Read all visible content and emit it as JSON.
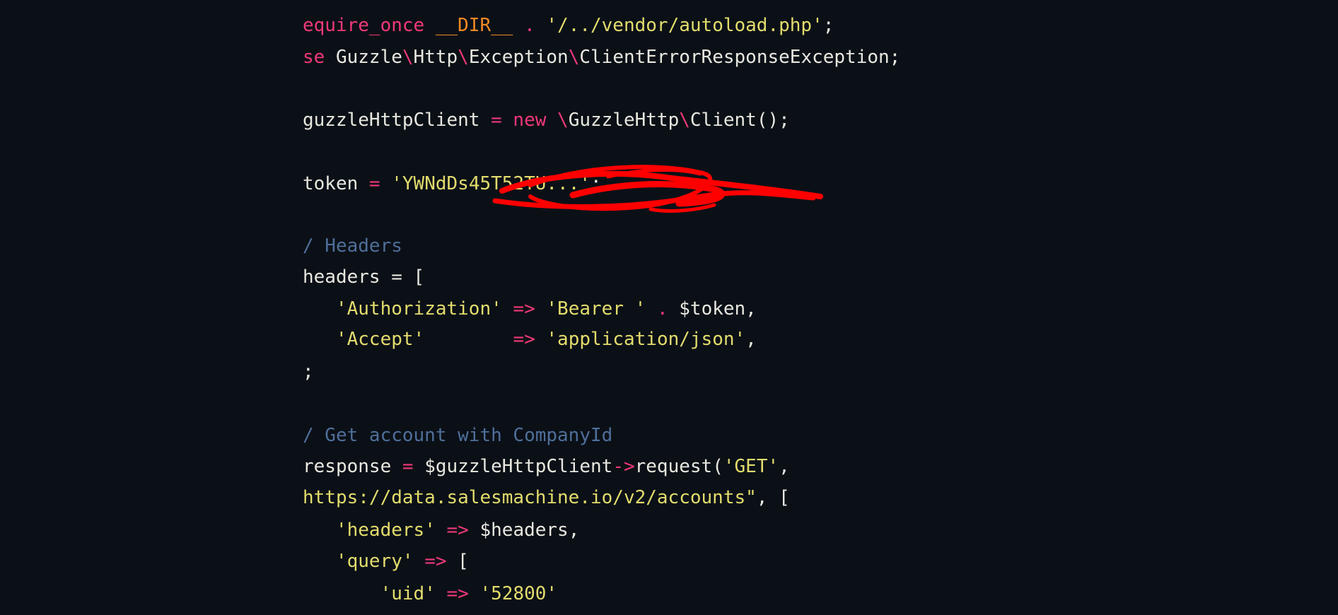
{
  "code": {
    "line1": {
      "kw": "equire_once",
      "sp1": " ",
      "const": "__DIR__",
      "op": " . ",
      "str": "'/../vendor/autoload.php'",
      "end": ";"
    },
    "line2": {
      "kw": "se",
      "ns1": " Guzzle",
      "sep1": "\\",
      "ns2": "Http",
      "sep2": "\\",
      "ns3": "Exception",
      "sep3": "\\",
      "cls": "ClientErrorResponseException;"
    },
    "line3": {
      "var": "guzzleHttpClient",
      "op": " = ",
      "kw": "new",
      "sep1": " \\",
      "ns": "GuzzleHttp",
      "sep2": "\\",
      "cls": "Client();"
    },
    "line4": {
      "var": "token",
      "op": " = ",
      "str": "'YWNdDs45T52TU...'",
      "end": ";"
    },
    "line5": {
      "comment": "/ Headers"
    },
    "line6": {
      "var": "headers",
      "op": " = [",
      "rest": ""
    },
    "line7": {
      "key": "'Authorization'",
      "arrow": " => ",
      "val": "'Bearer '",
      "op": " . ",
      "var": "$token,"
    },
    "line8": {
      "key": "'Accept'",
      "pad": "        ",
      "arrow": "=> ",
      "val": "'application/json'",
      "end": ","
    },
    "line9": {
      "end": ";"
    },
    "line10": {
      "comment": "/ Get account with CompanyId"
    },
    "line11": {
      "var": "response",
      "op": " = ",
      "obj": "$guzzleHttpClient",
      "arrow": "->",
      "fn": "request(",
      "str": "'GET'",
      "end": ","
    },
    "line12": {
      "str": "https://data.salesmachine.io/v2/accounts\"",
      "end": ", ["
    },
    "line13": {
      "key": "'headers'",
      "arrow": " => ",
      "var": "$headers,"
    },
    "line14": {
      "key": "'query'",
      "arrow": " => ",
      "end": "["
    },
    "line15": {
      "key": "'uid'",
      "arrow": " => ",
      "val": "'52800'"
    }
  },
  "colors": {
    "background": "#0b1017",
    "keyword": "#f0387b",
    "string": "#e3dc6d",
    "constant": "#f08a24",
    "comment": "#4f6f9a",
    "text": "#e8e8e0",
    "redaction": "#ff0000"
  }
}
